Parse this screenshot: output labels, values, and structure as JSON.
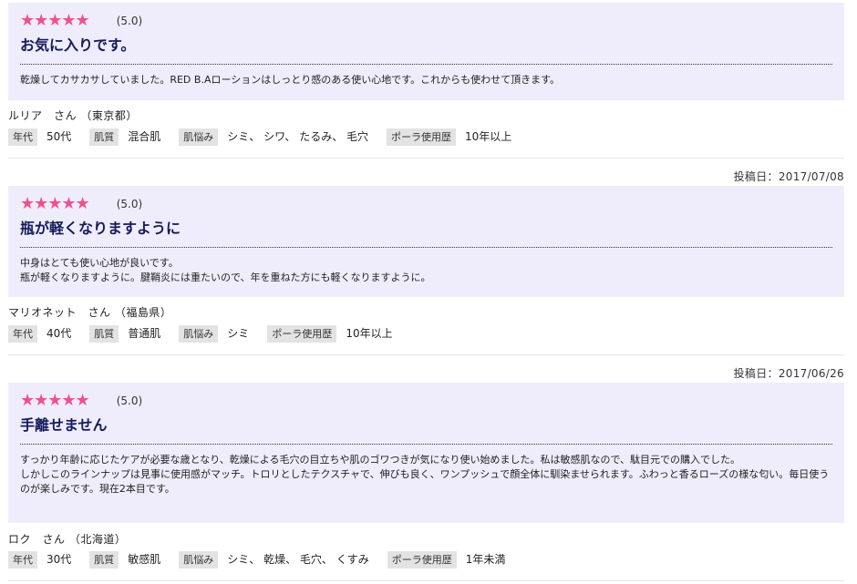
{
  "reviews": [
    {
      "date": "",
      "stars": "★★★★★",
      "score": "(5.0)",
      "title": "お気に入りです。",
      "body": [
        "乾燥してカサカサしていました。RED B.Aローションはしっとり感のある使い心地です。これからも使わせて頂きます。"
      ],
      "author": "ルリア　さん （東京都）",
      "attrs": [
        {
          "label": "年代",
          "value": "50代"
        },
        {
          "label": "肌質",
          "value": "混合肌"
        },
        {
          "label": "肌悩み",
          "value": "シミ、 シワ、 たるみ、 毛穴"
        },
        {
          "label": "ポーラ使用歴",
          "value": "10年以上"
        }
      ]
    },
    {
      "date": "投稿日：2017/07/08",
      "stars": "★★★★★",
      "score": "(5.0)",
      "title": "瓶が軽くなりますように",
      "body": [
        "中身はとても使い心地が良いです。",
        "瓶が軽くなりますように。腱鞘炎には重たいので、年を重ねた方にも軽くなりますように。"
      ],
      "author": "マリオネット　さん （福島県）",
      "attrs": [
        {
          "label": "年代",
          "value": "40代"
        },
        {
          "label": "肌質",
          "value": "普通肌"
        },
        {
          "label": "肌悩み",
          "value": "シミ"
        },
        {
          "label": "ポーラ使用歴",
          "value": "10年以上"
        }
      ]
    },
    {
      "date": "投稿日：2017/06/26",
      "stars": "★★★★★",
      "score": "(5.0)",
      "title": "手離せません",
      "body": [
        "すっかり年齢に応じたケアが必要な歳となり、乾燥による毛穴の目立ちや肌のゴワつきが気になり使い始めました。私は敏感肌なので、駄目元での購入でした。",
        "しかしこのラインナップは見事に使用感がマッチ。トロリとしたテクスチャで、伸びも良く、ワンプッシュで顔全体に馴染ませられます。ふわっと香るローズの様な匂い。毎日使うのが楽しみです。現在2本目です。"
      ],
      "author": "ロク　さん （北海道）",
      "attrs": [
        {
          "label": "年代",
          "value": "30代"
        },
        {
          "label": "肌質",
          "value": "敏感肌"
        },
        {
          "label": "肌悩み",
          "value": "シミ、 乾燥、 毛穴、 くすみ"
        },
        {
          "label": "ポーラ使用歴",
          "value": "1年未満"
        }
      ]
    }
  ],
  "colors": {
    "star": "#f0508c",
    "title": "#141b5a",
    "box": "#efedfb",
    "tag": "#e3e3e3"
  }
}
